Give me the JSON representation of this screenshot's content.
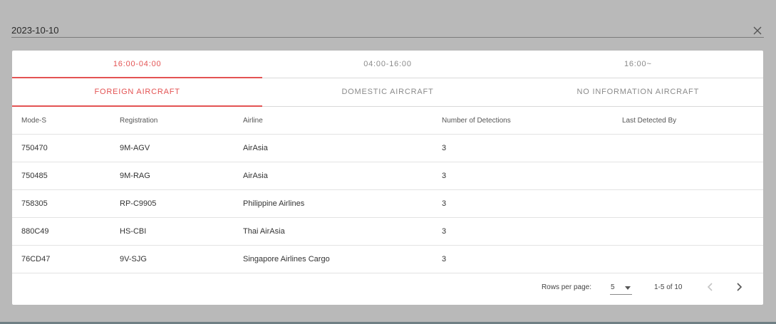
{
  "header": {
    "date": "2023-10-10"
  },
  "time_tabs": [
    {
      "label": "16:00-04:00",
      "active": true
    },
    {
      "label": "04:00-16:00",
      "active": false
    },
    {
      "label": "16:00~",
      "active": false
    }
  ],
  "type_tabs": [
    {
      "label": "FOREIGN AIRCRAFT",
      "active": true
    },
    {
      "label": "DOMESTIC AIRCRAFT",
      "active": false
    },
    {
      "label": "NO INFORMATION AIRCRAFT",
      "active": false
    }
  ],
  "table": {
    "columns": [
      "Mode-S",
      "Registration",
      "Airline",
      "Number of Detections",
      "Last Detected By"
    ],
    "rows": [
      [
        "750470",
        "9M-AGV",
        "AirAsia",
        "3",
        ""
      ],
      [
        "750485",
        "9M-RAG",
        "AirAsia",
        "3",
        ""
      ],
      [
        "758305",
        "RP-C9905",
        "Philippine Airlines",
        "3",
        ""
      ],
      [
        "880C49",
        "HS-CBI",
        "Thai AirAsia",
        "3",
        ""
      ],
      [
        "76CD47",
        "9V-SJG",
        "Singapore Airlines Cargo",
        "3",
        ""
      ]
    ]
  },
  "pagination": {
    "rows_per_page_label": "Rows per page:",
    "rows_per_page_value": "5",
    "range_text": "1-5 of 10"
  },
  "colors": {
    "accent": "#e35353",
    "backdrop": "#b9b9b9"
  }
}
